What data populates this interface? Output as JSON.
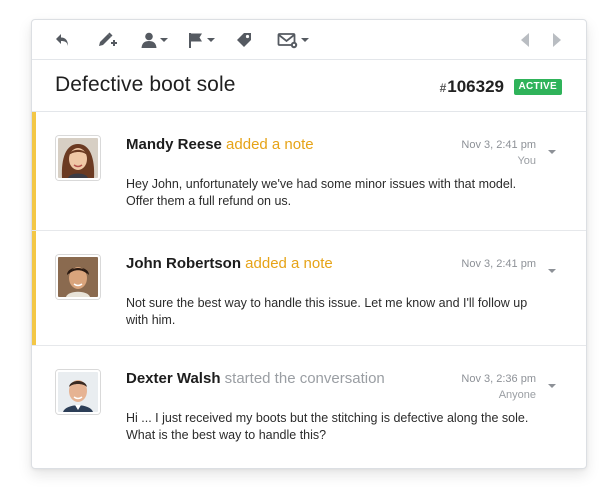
{
  "conversation": {
    "subject": "Defective boot sole",
    "ticket_hash": "#",
    "ticket_number": "106329",
    "status": "ACTIVE",
    "status_color": "#2fb35a"
  },
  "toolbar": {
    "icons": [
      "reply-icon",
      "edit-note-icon",
      "assign-user-icon",
      "flag-icon",
      "tag-icon",
      "email-settings-icon",
      "prev-icon",
      "next-icon"
    ]
  },
  "messages": [
    {
      "author": "Mandy Reese",
      "action": "added a note",
      "time": "Nov 3, 2:41 pm",
      "recipient": "You",
      "body": "Hey John, unfortunately we've had some minor issues with that model. Offer them a full refund on us.",
      "type": "note"
    },
    {
      "author": "John Robertson",
      "action": "added a note",
      "time": "Nov 3, 2:41 pm",
      "recipient": "",
      "body": "Not sure the best way to handle this issue. Let me know and I'll follow up with him.",
      "type": "note"
    },
    {
      "author": "Dexter Walsh",
      "action": "started the conversation",
      "time": "Nov 3, 2:36 pm",
      "recipient": "Anyone",
      "body": "Hi ... I just received my boots but the stitching is defective along the sole. What is the best way to handle this?",
      "type": "customer"
    }
  ],
  "colors": {
    "note_accent": "#f3c746",
    "note_action": "#e6a317"
  }
}
